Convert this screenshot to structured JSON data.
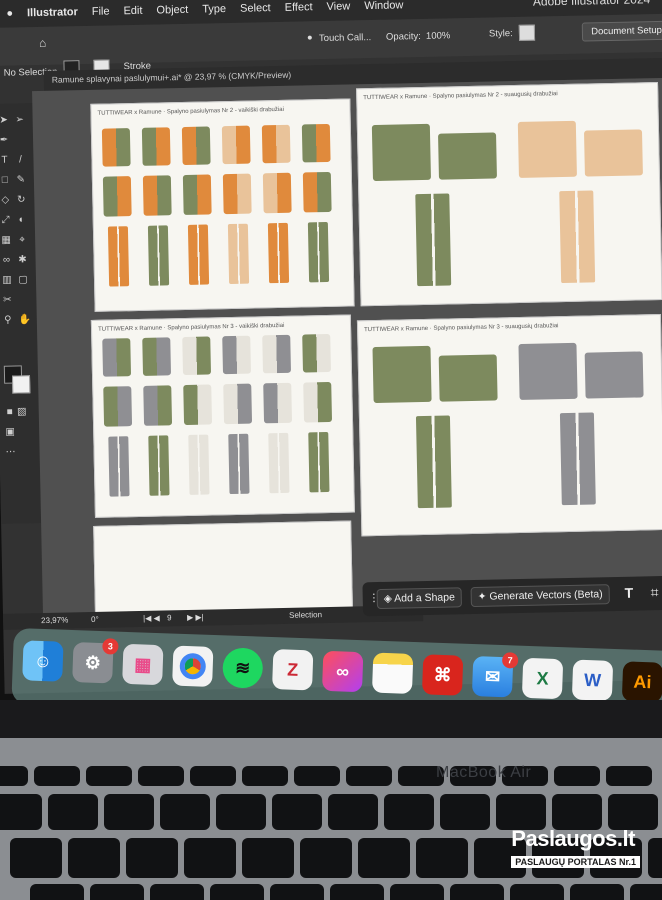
{
  "menubar": {
    "app": "Illustrator",
    "items": [
      "File",
      "Edit",
      "Object",
      "Type",
      "Select",
      "Effect",
      "View",
      "Window"
    ],
    "window_title": "Adobe Illustrator 2024"
  },
  "control_bar": {
    "selection_label": "No Selection",
    "stroke_label": "Stroke",
    "touch_label": "Touch Call...",
    "opacity_label": "Opacity:",
    "opacity_value": "100%",
    "style_label": "Style:",
    "document_setup": "Document Setup"
  },
  "document_tab": {
    "title": "Ramune splavynai paslulymui+.ai* @ 23,97 % (CMYK/Preview)"
  },
  "artboards": [
    {
      "title": "TUTTIWEAR x Ramune · Spalyno pasiulymas Nr 2 - vaikiški drabužiai"
    },
    {
      "title": "TUTTIWEAR x Ramune · Spalyno pasiulymas Nr 2 - suaugusių drabužiai"
    },
    {
      "title": "TUTTIWEAR x Ramune · Spalyno pasiulymas Nr 3 - vaikiški drabužiai"
    },
    {
      "title": "TUTTIWEAR x Ramune · Spalyno pasiulymas Nr 3 - suaugusių drabužiai"
    }
  ],
  "status_bar": {
    "zoom": "23,97%",
    "rotation": "0°",
    "artboard": "9",
    "tool": "Selection"
  },
  "context_bar": {
    "add_shape": "Add a Shape",
    "generate_vectors": "Generate Vectors (Beta)"
  },
  "dock": {
    "badges": {
      "settings": "3",
      "mail": "7"
    }
  },
  "laptop": {
    "model": "MacBook Air"
  },
  "watermark": {
    "name": "Paslaugos.lt",
    "tagline": "PASLAUGŲ PORTALAS",
    "number": "Nr.1"
  },
  "colors": {
    "olive": "#7d8a5e",
    "orange": "#e08a3c",
    "sand": "#e9c39a",
    "grey": "#8f8f93",
    "light": "#e6e3db"
  }
}
